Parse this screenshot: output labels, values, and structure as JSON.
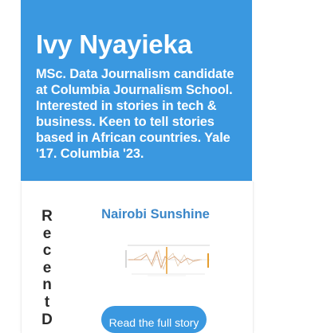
{
  "profile": {
    "name": "Ivy Nyayieka",
    "bio_lines": [
      "MSc. Data Journalism candidate",
      "at Columbia Journalism School.",
      "Interested in stories in tech &",
      "business. Keen to tell stories",
      "based in African countries. Yale",
      "'17. Columbia '23."
    ]
  },
  "recent": {
    "letters": [
      "R",
      "e",
      "c",
      "e",
      "n",
      "t",
      "D"
    ]
  },
  "story": {
    "title": "Nairobi Sunshine",
    "button_label": "Read the full story"
  },
  "colors": {
    "accent": "#3a98e0",
    "link": "#3a86c8"
  }
}
